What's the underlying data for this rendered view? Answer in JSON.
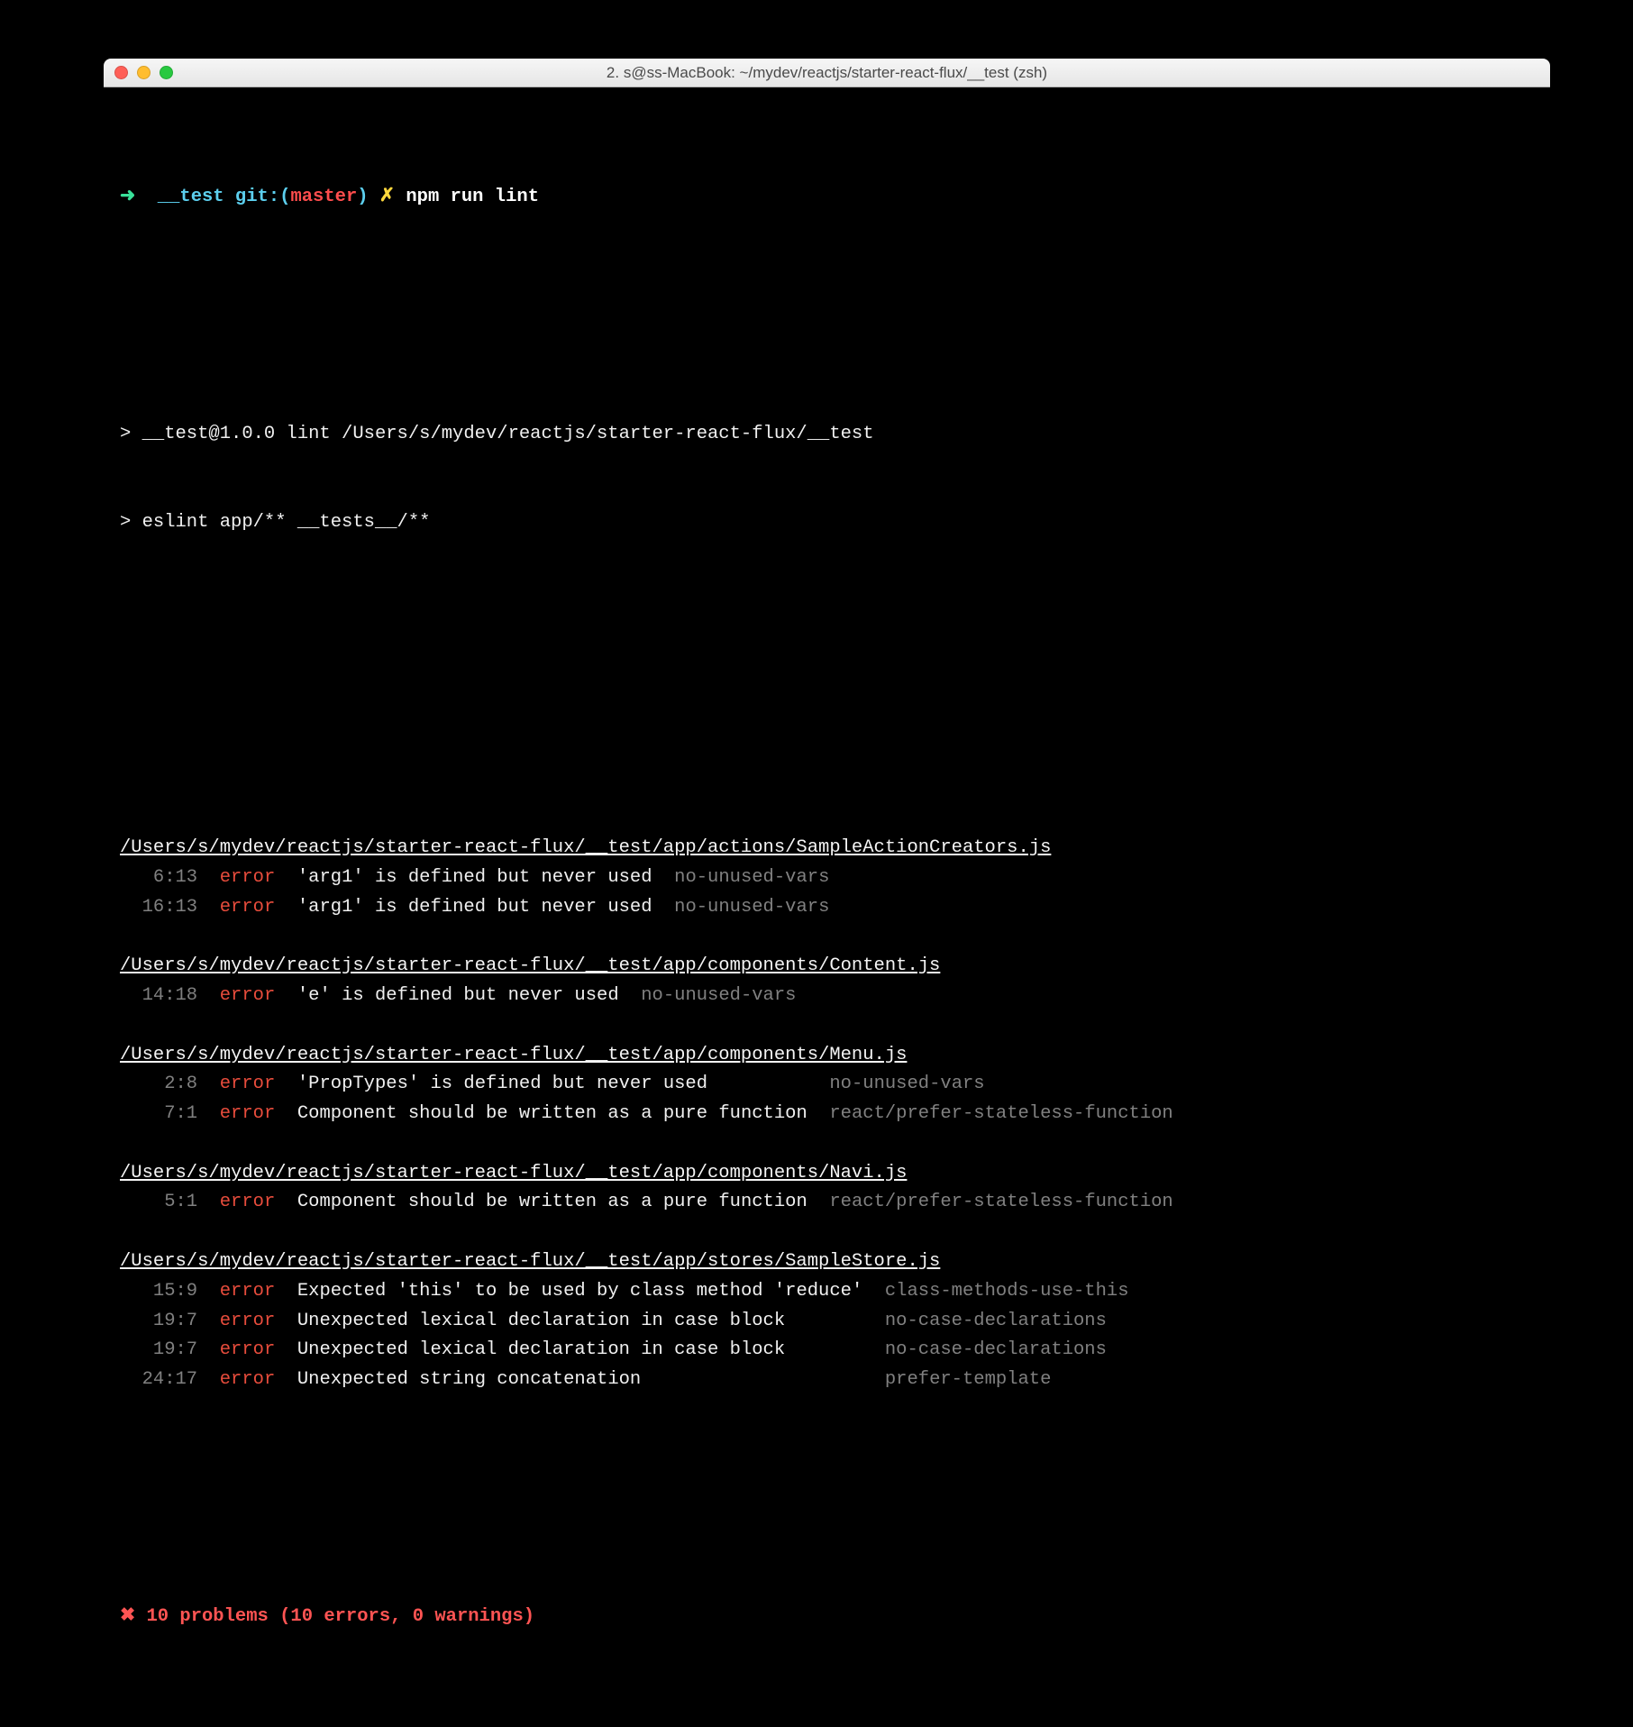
{
  "window": {
    "title": "2. s@ss-MacBook: ~/mydev/reactjs/starter-react-flux/__test (zsh)"
  },
  "prompt": {
    "arrow": "➜",
    "cwd": "__test",
    "git_label": "git:(",
    "branch": "master",
    "git_close": ")",
    "dirty": "✗",
    "command": "npm run lint"
  },
  "npm_output": {
    "line1": "> __test@1.0.0 lint /Users/s/mydev/reactjs/starter-react-flux/__test",
    "line2": "> eslint app/** __tests__/**"
  },
  "files": [
    {
      "path": "/Users/s/mydev/reactjs/starter-react-flux/__test/app/actions/SampleActionCreators.js",
      "errors": [
        {
          "loc": "6:13",
          "sev": "error",
          "msg": "'arg1' is defined but never used",
          "rule": "no-unused-vars"
        },
        {
          "loc": "16:13",
          "sev": "error",
          "msg": "'arg1' is defined but never used",
          "rule": "no-unused-vars"
        }
      ]
    },
    {
      "path": "/Users/s/mydev/reactjs/starter-react-flux/__test/app/components/Content.js",
      "errors": [
        {
          "loc": "14:18",
          "sev": "error",
          "msg": "'e' is defined but never used",
          "rule": "no-unused-vars"
        }
      ]
    },
    {
      "path": "/Users/s/mydev/reactjs/starter-react-flux/__test/app/components/Menu.js",
      "errors": [
        {
          "loc": "2:8",
          "sev": "error",
          "msg": "'PropTypes' is defined but never used",
          "rule": "no-unused-vars"
        },
        {
          "loc": "7:1",
          "sev": "error",
          "msg": "Component should be written as a pure function",
          "rule": "react/prefer-stateless-function"
        }
      ]
    },
    {
      "path": "/Users/s/mydev/reactjs/starter-react-flux/__test/app/components/Navi.js",
      "errors": [
        {
          "loc": "5:1",
          "sev": "error",
          "msg": "Component should be written as a pure function",
          "rule": "react/prefer-stateless-function"
        }
      ]
    },
    {
      "path": "/Users/s/mydev/reactjs/starter-react-flux/__test/app/stores/SampleStore.js",
      "errors": [
        {
          "loc": "15:9",
          "sev": "error",
          "msg": "Expected 'this' to be used by class method 'reduce'",
          "rule": "class-methods-use-this"
        },
        {
          "loc": "19:7",
          "sev": "error",
          "msg": "Unexpected lexical declaration in case block",
          "rule": "no-case-declarations"
        },
        {
          "loc": "19:7",
          "sev": "error",
          "msg": "Unexpected lexical declaration in case block",
          "rule": "no-case-declarations"
        },
        {
          "loc": "24:17",
          "sev": "error",
          "msg": "Unexpected string concatenation",
          "rule": "prefer-template"
        }
      ]
    }
  ],
  "summary": {
    "icon": "✖",
    "text": "10 problems (10 errors, 0 warnings)"
  },
  "colors": {
    "bg": "#000000",
    "fg": "#e5e5e5",
    "gray": "#808080",
    "error": "#e74c3c",
    "summary": "#ff5453",
    "arrow": "#39e29a",
    "cyan": "#5ccfee",
    "yellow": "#ffd83d",
    "branch_red": "#ff4d4d"
  }
}
